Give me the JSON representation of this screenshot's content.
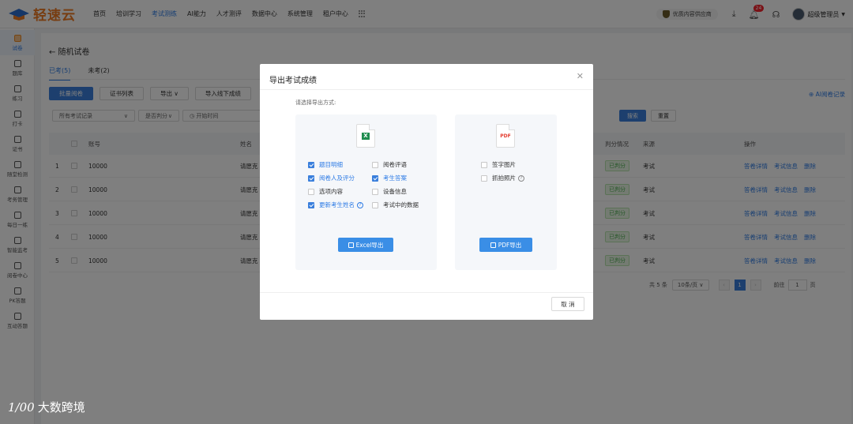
{
  "header": {
    "brand": "轻速云",
    "nav": [
      "首页",
      "培训学习",
      "考试测练",
      "AI能力",
      "人才测评",
      "数据中心",
      "系统管理",
      "租户中心"
    ],
    "active_nav": 2,
    "promo": "优质内容供应商",
    "notif_count": "24",
    "user_name": "超级管理员",
    "accent_color": "#2d7be5",
    "brand_color": "#ee7a22"
  },
  "sidebar": {
    "items": [
      {
        "label": "试卷",
        "icon": "exam-paper-icon",
        "active": true
      },
      {
        "label": "题库",
        "icon": "question-bank-icon"
      },
      {
        "label": "练习",
        "icon": "pencil-icon"
      },
      {
        "label": "打卡",
        "icon": "checkin-icon"
      },
      {
        "label": "证书",
        "icon": "certificate-icon"
      },
      {
        "label": "随堂检测",
        "icon": "quiz-icon"
      },
      {
        "label": "考务管理",
        "icon": "exam-admin-icon"
      },
      {
        "label": "每日一练",
        "icon": "daily-practice-icon"
      },
      {
        "label": "智能监考",
        "icon": "proctor-icon"
      },
      {
        "label": "阅卷中心",
        "icon": "grading-icon"
      },
      {
        "label": "PK答题",
        "icon": "pk-icon"
      },
      {
        "label": "互动答题",
        "icon": "interactive-icon"
      }
    ]
  },
  "page": {
    "back_title": "← 随机试卷",
    "tabs": [
      "已考(5)",
      "未考(2)"
    ],
    "toolbar": [
      "批量阅卷",
      "证书列表",
      "导出 ∨",
      "导入线下成绩"
    ],
    "ai_link": "AI阅卷记录",
    "filters": {
      "record": "所有考试记录",
      "grading": "是否判分",
      "time": "开始时间"
    },
    "search_label": "搜索",
    "reset_label": "重置",
    "columns": {
      "account": "账号",
      "name": "姓名",
      "status": "判分情况",
      "source": "来源",
      "ops": "操作"
    },
    "rows": [
      {
        "idx": "1",
        "account": "10000",
        "name": "请愿克",
        "status": "已判分",
        "source": "考试"
      },
      {
        "idx": "2",
        "account": "10000",
        "name": "请愿克",
        "status": "已判分",
        "source": "考试"
      },
      {
        "idx": "3",
        "account": "10000",
        "name": "请愿克",
        "status": "已判分",
        "source": "考试"
      },
      {
        "idx": "4",
        "account": "10000",
        "name": "请愿克",
        "status": "已判分",
        "source": "考试"
      },
      {
        "idx": "5",
        "account": "10000",
        "name": "请愿克",
        "status": "已判分",
        "source": "考试"
      }
    ],
    "row_ops": [
      "答卷详情",
      "考试信息",
      "删除"
    ],
    "pager": {
      "total": "共 5 条",
      "size": "10条/页",
      "current": "1",
      "goto": "前往",
      "page_unit": "页"
    }
  },
  "modal": {
    "title": "导出考试成绩",
    "hint": "请选择导出方式:",
    "excel_options": [
      {
        "label": "题目明细",
        "checked": true
      },
      {
        "label": "阅卷评语",
        "checked": false
      },
      {
        "label": "阅卷人及评分",
        "checked": true
      },
      {
        "label": "考生答案",
        "checked": true
      },
      {
        "label": "选项内容",
        "checked": false
      },
      {
        "label": "设备信息",
        "checked": false
      },
      {
        "label": "更新考生姓名",
        "checked": true,
        "help": true
      },
      {
        "label": "考试中的数据",
        "checked": false
      }
    ],
    "pdf_options": [
      {
        "label": "签字图片",
        "checked": false
      },
      {
        "label": "抓拍照片",
        "checked": false,
        "help": true
      }
    ],
    "excel_btn": "Excel导出",
    "pdf_btn": "PDF导出",
    "pdf_mark": "PDF",
    "xls_mark": "X",
    "cancel": "取 消"
  },
  "watermark": {
    "logo": "1/00",
    "text": "大数跨境"
  }
}
